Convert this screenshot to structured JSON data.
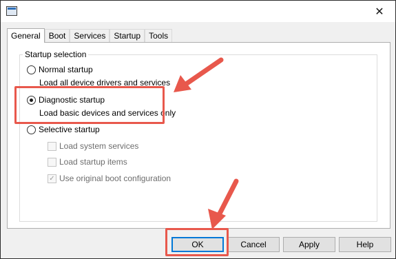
{
  "window": {
    "close_glyph": "✕"
  },
  "tabs": [
    {
      "label": "General",
      "active": true
    },
    {
      "label": "Boot"
    },
    {
      "label": "Services"
    },
    {
      "label": "Startup"
    },
    {
      "label": "Tools"
    }
  ],
  "startup": {
    "group_label": "Startup selection",
    "normal": {
      "label": "Normal startup",
      "desc": "Load all device drivers and services",
      "checked": false
    },
    "diagnostic": {
      "label": "Diagnostic startup",
      "desc": "Load basic devices and services only",
      "checked": true
    },
    "selective": {
      "label": "Selective startup",
      "checked": false
    },
    "sub_options": [
      {
        "label": "Load system services",
        "checked": false
      },
      {
        "label": "Load startup items",
        "checked": false
      },
      {
        "label": "Use original boot configuration",
        "checked": true
      }
    ]
  },
  "buttons": {
    "ok": "OK",
    "cancel": "Cancel",
    "apply": "Apply",
    "help": "Help"
  },
  "colors": {
    "annotation": "#e8584c",
    "accent": "#0078d7"
  }
}
